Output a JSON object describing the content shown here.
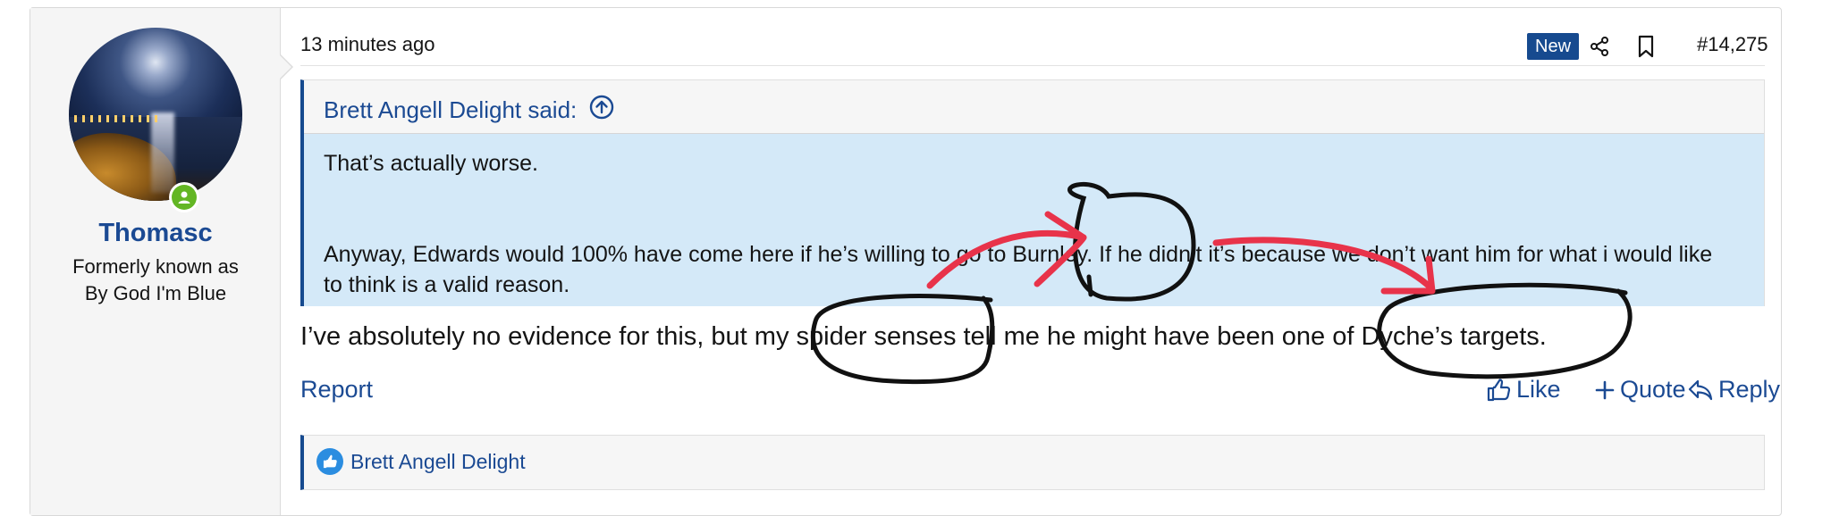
{
  "post": {
    "timestamp": "13 minutes ago",
    "new_badge": "New",
    "post_number": "#14,275",
    "message": "I’ve absolutely no evidence for this, but my spider senses tell me he might have been one of Dyche’s targets."
  },
  "user": {
    "name": "Thomasc",
    "title": "Formerly known as By God I'm Blue",
    "online_icon": "user-online-icon"
  },
  "quote": {
    "author": "Brett Angell Delight said:",
    "line1": "That’s actually worse.",
    "line2": "Anyway, Edwards would 100% have come here if he’s willing to go to Burnley. If he didn’t it’s because we don’t want him for what i would like to think is a valid reason."
  },
  "actions": {
    "report": "Report",
    "like": "Like",
    "quote": "Quote",
    "reply": "Reply"
  },
  "reactions": {
    "users": "Brett Angell Delight"
  },
  "colors": {
    "link": "#1b4a93",
    "badge": "#164a8f",
    "quote_bg": "#d4e9f8",
    "online": "#63b624",
    "annotation_red": "#e8334a"
  }
}
